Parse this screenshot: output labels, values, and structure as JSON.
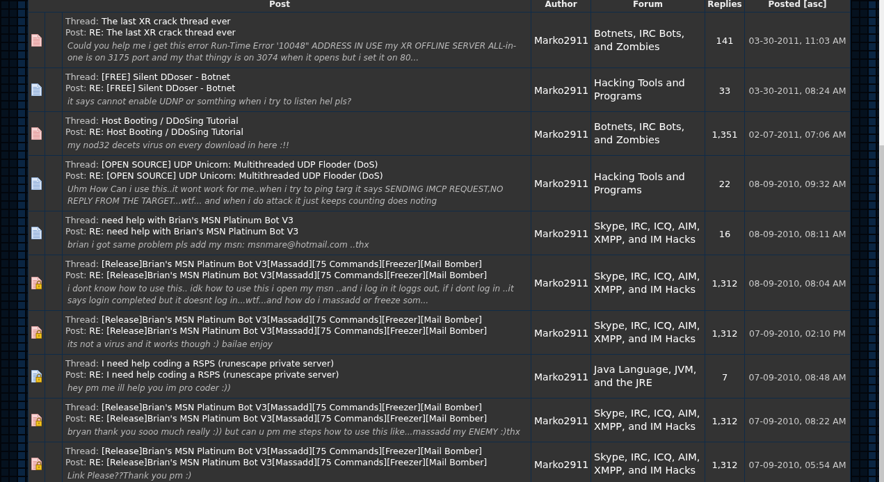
{
  "table": {
    "columns": [
      {
        "label": "Post"
      },
      {
        "label": "Author"
      },
      {
        "label": "Forum"
      },
      {
        "label": "Replies"
      },
      {
        "label": "Posted [asc]"
      }
    ],
    "rows": [
      {
        "hot": true,
        "locked": false,
        "thread_label": "Thread:",
        "thread": "The last XR crack thread ever",
        "post_label": "Post:",
        "post": "RE: The last XR crack thread ever",
        "preview": "Could you help me i get this error Run-Time Error '10048\" ADDRESS IN USE my XR OFFLINE SERVER ALL-in-one is on 3175 port and my that thingy is on 3074 when it opens but i set it on 80...",
        "author": "Marko2911",
        "forum": "Botnets, IRC Bots, and Zombies",
        "replies": "141",
        "posted": "03-30-2011, 11:03 AM"
      },
      {
        "hot": false,
        "locked": false,
        "thread_label": "Thread:",
        "thread": "[FREE] Silent DDoser - Botnet",
        "post_label": "Post:",
        "post": "RE: [FREE] Silent DDoser - Botnet",
        "preview": "it says cannot enable UDNP or somthing when i try to listen hel pls?",
        "author": "Marko2911",
        "forum": "Hacking Tools and Programs",
        "replies": "33",
        "posted": "03-30-2011, 08:24 AM"
      },
      {
        "hot": true,
        "locked": false,
        "thread_label": "Thread:",
        "thread": "Host Booting / DDoSing Tutorial",
        "post_label": "Post:",
        "post": "RE: Host Booting / DDoSing Tutorial",
        "preview": "my nod32 decets virus on every download in here :!!",
        "author": "Marko2911",
        "forum": "Botnets, IRC Bots, and Zombies",
        "replies": "1,351",
        "posted": "02-07-2011, 07:06 AM"
      },
      {
        "hot": false,
        "locked": false,
        "thread_label": "Thread:",
        "thread": "[OPEN SOURCE] UDP Unicorn: Multithreaded UDP Flooder (DoS)",
        "post_label": "Post:",
        "post": "RE: [OPEN SOURCE] UDP Unicorn: Multithreaded UDP Flooder (DoS)",
        "preview": "Uhm How Can i use this..it wont work for me..when i try to ping targ it says SENDING IMCP REQUEST,NO REPLY FROM THE TARGET...wtf... and when i do attack it just keeps counting does noting",
        "author": "Marko2911",
        "forum": "Hacking Tools and Programs",
        "replies": "22",
        "posted": "08-09-2010, 09:32 AM"
      },
      {
        "hot": false,
        "locked": false,
        "thread_label": "Thread:",
        "thread": "need help with Brian's MSN Platinum Bot V3",
        "post_label": "Post:",
        "post": "RE: need help with Brian's MSN Platinum Bot V3",
        "preview": "brian i got same problem pls add my msn: msnmare@hotmail.com ..thx",
        "author": "Marko2911",
        "forum": "Skype, IRC, ICQ, AIM, XMPP, and IM Hacks",
        "replies": "16",
        "posted": "08-09-2010, 08:11 AM"
      },
      {
        "hot": true,
        "locked": true,
        "thread_label": "Thread:",
        "thread": "[Release]Brian's MSN Platinum Bot V3[Massadd][75 Commands][Freezer][Mail Bomber]",
        "post_label": "Post:",
        "post": "RE: [Release]Brian's MSN Platinum Bot V3[Massadd][75 Commands][Freezer][Mail Bomber]",
        "preview": "i dont know how to use this.. idk how to use this i open my msn ..and i log in it loggs out, if i dont log in ..it says login completed but it doesnt log in...wtf...and how do i massadd or freeze som...",
        "author": "Marko2911",
        "forum": "Skype, IRC, ICQ, AIM, XMPP, and IM Hacks",
        "replies": "1,312",
        "posted": "08-09-2010, 08:04 AM"
      },
      {
        "hot": true,
        "locked": true,
        "thread_label": "Thread:",
        "thread": "[Release]Brian's MSN Platinum Bot V3[Massadd][75 Commands][Freezer][Mail Bomber]",
        "post_label": "Post:",
        "post": "RE: [Release]Brian's MSN Platinum Bot V3[Massadd][75 Commands][Freezer][Mail Bomber]",
        "preview": "its not a virus and it works though :) bailae enjoy",
        "author": "Marko2911",
        "forum": "Skype, IRC, ICQ, AIM, XMPP, and IM Hacks",
        "replies": "1,312",
        "posted": "07-09-2010, 02:10 PM"
      },
      {
        "hot": false,
        "locked": true,
        "thread_label": "Thread:",
        "thread": "I need help coding a RSPS (runescape private server)",
        "post_label": "Post:",
        "post": "RE: I need help coding a RSPS (runescape private server)",
        "preview": "hey pm me ill help you im pro coder :))",
        "author": "Marko2911",
        "forum": "Java Language, JVM, and the JRE",
        "replies": "7",
        "posted": "07-09-2010, 08:48 AM"
      },
      {
        "hot": true,
        "locked": true,
        "thread_label": "Thread:",
        "thread": "[Release]Brian's MSN Platinum Bot V3[Massadd][75 Commands][Freezer][Mail Bomber]",
        "post_label": "Post:",
        "post": "RE: [Release]Brian's MSN Platinum Bot V3[Massadd][75 Commands][Freezer][Mail Bomber]",
        "preview": "bryan thank you sooo much really :)) but can u pm me steps how to use this like...massadd my ENEMY :)thx",
        "author": "Marko2911",
        "forum": "Skype, IRC, ICQ, AIM, XMPP, and IM Hacks",
        "replies": "1,312",
        "posted": "07-09-2010, 08:22 AM"
      },
      {
        "hot": true,
        "locked": true,
        "thread_label": "Thread:",
        "thread": "[Release]Brian's MSN Platinum Bot V3[Massadd][75 Commands][Freezer][Mail Bomber]",
        "post_label": "Post:",
        "post": "RE: [Release]Brian's MSN Platinum Bot V3[Massadd][75 Commands][Freezer][Mail Bomber]",
        "preview": "Link Please??Thank you pm :)",
        "author": "Marko2911",
        "forum": "Skype, IRC, ICQ, AIM, XMPP, and IM Hacks",
        "replies": "1,312",
        "posted": "07-09-2010, 05:54 AM"
      }
    ]
  }
}
